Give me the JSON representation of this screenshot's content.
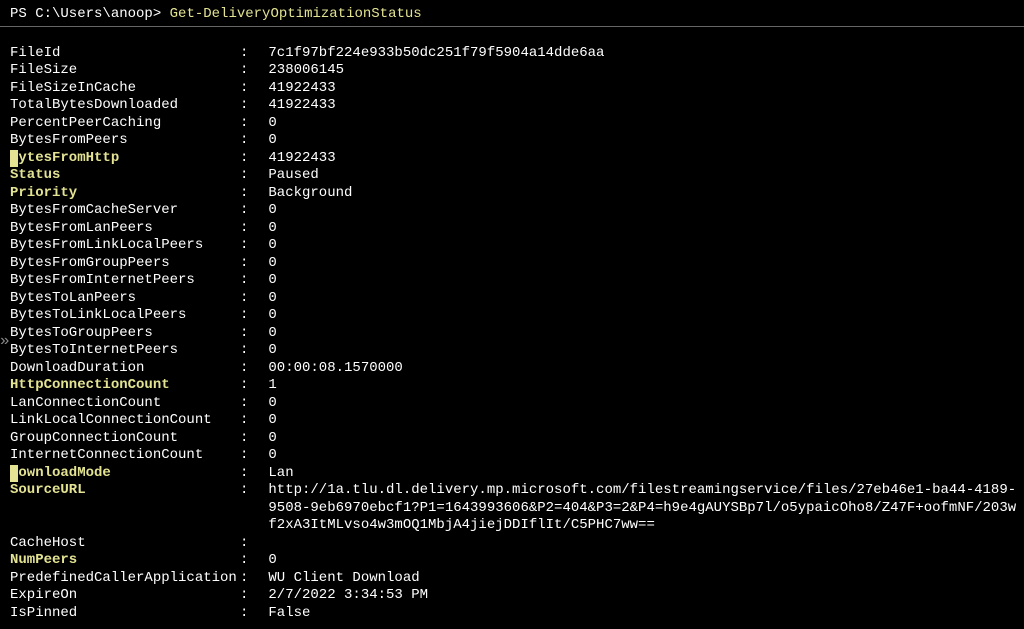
{
  "prompt": {
    "prefix": "PS C:\\Users\\anoop> ",
    "command": "Get-DeliveryOptimizationStatus"
  },
  "sep": ": ",
  "rows": [
    {
      "key": "FileId",
      "val": "7c1f97bf224e933b50dc251f79f5904a14dde6aa",
      "hl": false
    },
    {
      "key": "FileSize",
      "val": "238006145",
      "hl": false
    },
    {
      "key": "FileSizeInCache",
      "val": "41922433",
      "hl": false
    },
    {
      "key": "TotalBytesDownloaded",
      "val": "41922433",
      "hl": false
    },
    {
      "key": "PercentPeerCaching",
      "val": "0",
      "hl": false
    },
    {
      "key": "BytesFromPeers",
      "val": "0",
      "hl": false
    },
    {
      "key": "BytesFromHttp",
      "val": "41922433",
      "hl": true,
      "marker": true
    },
    {
      "key": "Status",
      "val": "Paused",
      "hl": true
    },
    {
      "key": "Priority",
      "val": "Background",
      "hl": true
    },
    {
      "key": "BytesFromCacheServer",
      "val": "0",
      "hl": false
    },
    {
      "key": "BytesFromLanPeers",
      "val": "0",
      "hl": false
    },
    {
      "key": "BytesFromLinkLocalPeers",
      "val": "0",
      "hl": false
    },
    {
      "key": "BytesFromGroupPeers",
      "val": "0",
      "hl": false
    },
    {
      "key": "BytesFromInternetPeers",
      "val": "0",
      "hl": false
    },
    {
      "key": "BytesToLanPeers",
      "val": "0",
      "hl": false
    },
    {
      "key": "BytesToLinkLocalPeers",
      "val": "0",
      "hl": false
    },
    {
      "key": "BytesToGroupPeers",
      "val": "0",
      "hl": false
    },
    {
      "key": "BytesToInternetPeers",
      "val": "0",
      "hl": false
    },
    {
      "key": "DownloadDuration",
      "val": "00:00:08.1570000",
      "hl": false
    },
    {
      "key": "HttpConnectionCount",
      "val": "1",
      "hl": true
    },
    {
      "key": "LanConnectionCount",
      "val": "0",
      "hl": false
    },
    {
      "key": "LinkLocalConnectionCount",
      "val": "0",
      "hl": false
    },
    {
      "key": "GroupConnectionCount",
      "val": "0",
      "hl": false
    },
    {
      "key": "InternetConnectionCount",
      "val": "0",
      "hl": false
    },
    {
      "key": "DownloadMode",
      "val": "Lan",
      "hl": true,
      "marker": true
    },
    {
      "key": "SourceURL",
      "val": "http://1a.tlu.dl.delivery.mp.microsoft.com/filestreamingservice/files/27eb46e1-ba44-4189-",
      "hl": true,
      "wrap": [
        "9508-9eb6970ebcf1?P1=1643993606&P2=404&P3=2&P4=h9e4gAUYSBp7l/o5ypaicOho8/Z47F+oofmNF/203w",
        "f2xA3ItMLvso4w3mOQ1MbjA4jiejDDIflIt/C5PHC7ww=="
      ]
    },
    {
      "key": "CacheHost",
      "val": "",
      "hl": false
    },
    {
      "key": "NumPeers",
      "val": "0",
      "hl": true
    },
    {
      "key": "PredefinedCallerApplication",
      "val": "WU Client Download",
      "hl": false
    },
    {
      "key": "ExpireOn",
      "val": "2/7/2022 3:34:53 PM",
      "hl": false
    },
    {
      "key": "IsPinned",
      "val": "False",
      "hl": false
    }
  ],
  "arrows": "»"
}
